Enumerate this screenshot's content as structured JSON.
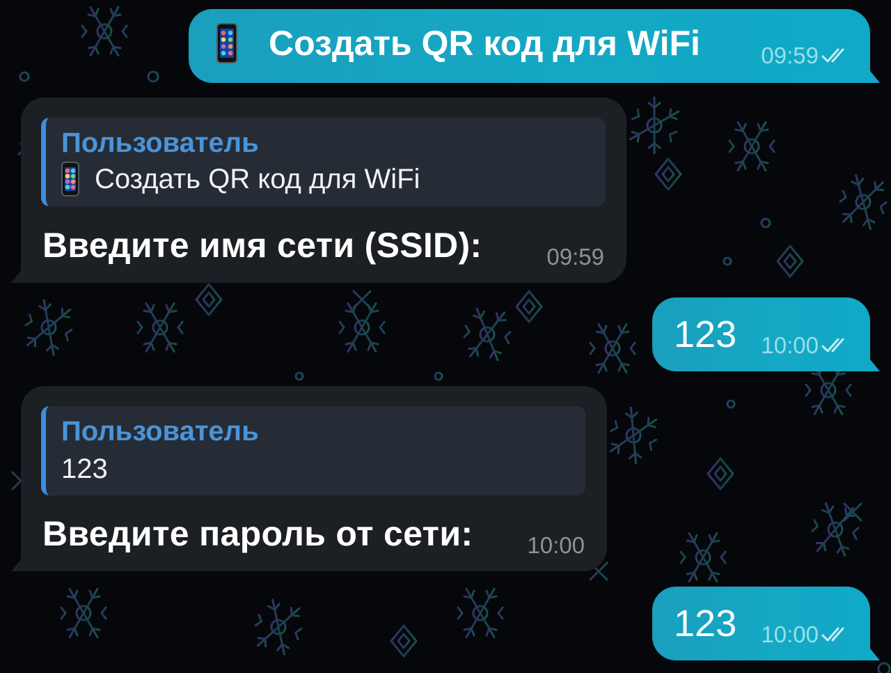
{
  "chat": {
    "messages": [
      {
        "direction": "outgoing",
        "emoji": "mobile-phone-icon",
        "text": "Создать QR код для WiFi",
        "time": "09:59",
        "status": "read"
      },
      {
        "direction": "incoming",
        "reply": {
          "author": "Пользователь",
          "emoji": "mobile-phone-icon",
          "text": "Создать QR код для WiFi"
        },
        "text": "Введите имя сети (SSID):",
        "time": "09:59"
      },
      {
        "direction": "outgoing",
        "text": "123",
        "time": "10:00",
        "status": "read"
      },
      {
        "direction": "incoming",
        "reply": {
          "author": "Пользователь",
          "text": "123"
        },
        "text": "Введите пароль от сети:",
        "time": "10:00"
      },
      {
        "direction": "outgoing",
        "text": "123",
        "time": "10:00",
        "status": "read"
      }
    ]
  },
  "colors": {
    "background": "#05070a",
    "outgoing_bubble": "#14a8c4",
    "incoming_bubble": "#1c1f24",
    "reply_author": "#4a94d9",
    "reply_bar": "#3d8ee0"
  }
}
